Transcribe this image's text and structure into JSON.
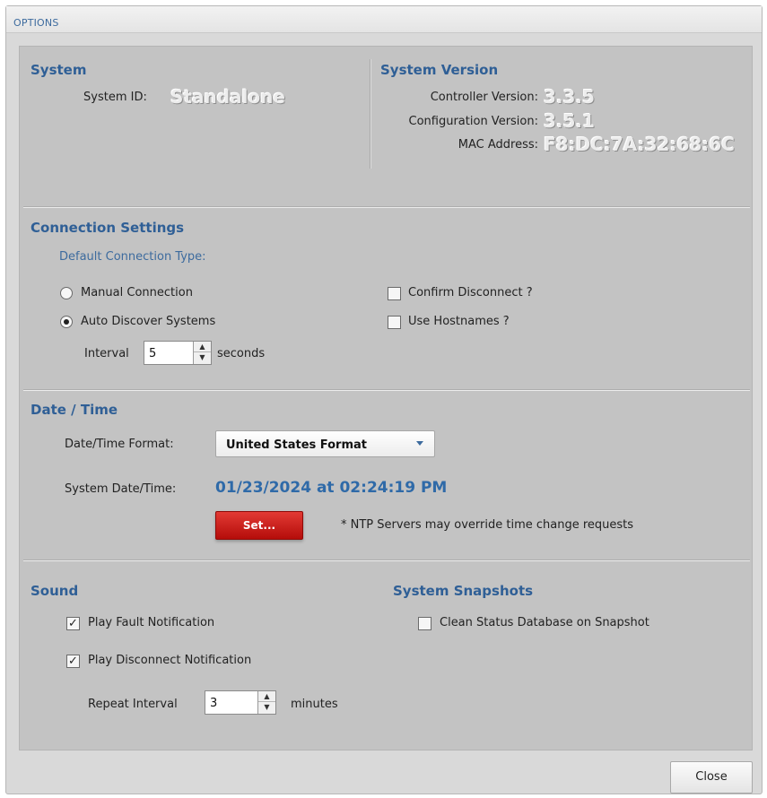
{
  "window": {
    "title": "OPTIONS"
  },
  "system": {
    "heading": "System",
    "id_label": "System ID:",
    "id_value": "Standalone"
  },
  "version": {
    "heading": "System Version",
    "controller_label": "Controller Version:",
    "controller_value": "3.3.5",
    "config_label": "Configuration Version:",
    "config_value": "3.5.1",
    "mac_label": "MAC Address:",
    "mac_value": "F8:DC:7A:32:68:6C"
  },
  "connection": {
    "heading": "Connection Settings",
    "default_label": "Default Connection Type:",
    "manual_label": "Manual Connection",
    "manual_selected": false,
    "auto_label": "Auto Discover Systems",
    "auto_selected": true,
    "interval_label": "Interval",
    "interval_value": "5",
    "interval_unit": "seconds",
    "confirm_label": "Confirm Disconnect ?",
    "confirm_checked": false,
    "hostnames_label": "Use Hostnames ?",
    "hostnames_checked": false
  },
  "datetime": {
    "heading": "Date / Time",
    "format_label": "Date/Time Format:",
    "format_value": "United States Format",
    "system_label": "System Date/Time:",
    "system_value": "01/23/2024 at 02:24:19 PM",
    "set_label": "Set...",
    "ntp_note": "* NTP Servers may override time change requests"
  },
  "sound": {
    "heading": "Sound",
    "fault_label": "Play Fault Notification",
    "fault_checked": true,
    "disconnect_label": "Play Disconnect Notification",
    "disconnect_checked": true,
    "repeat_label": "Repeat Interval",
    "repeat_value": "3",
    "repeat_unit": "minutes"
  },
  "snapshots": {
    "heading": "System Snapshots",
    "clean_label": "Clean Status Database on Snapshot",
    "clean_checked": false
  },
  "footer": {
    "close_label": "Close"
  },
  "colors": {
    "heading": "#2f5f96",
    "accent": "#2f6aa8",
    "set_button": "#c8201b"
  }
}
